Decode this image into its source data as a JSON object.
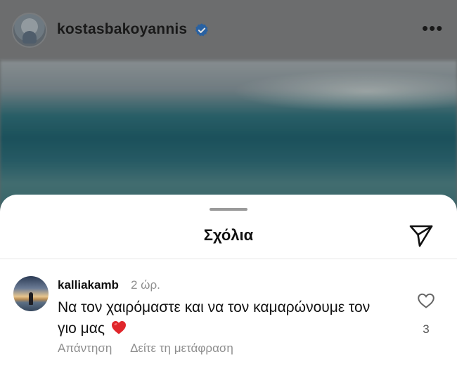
{
  "post": {
    "username": "kostasbakoyannis",
    "verified": true,
    "more_label": "•••",
    "icons": {
      "avatar": "profile-photo",
      "verified": "verified-badge-icon",
      "more": "more-options-icon"
    }
  },
  "comments_sheet": {
    "title": "Σχόλια",
    "share_icon": "send-icon",
    "comments": [
      {
        "username": "kalliakamb",
        "time": "2 ώρ.",
        "text": "Να τον χαιρόμαστε και να τον καμαρώνουμε τον γιο μας",
        "emoji": "heart",
        "reply_label": "Απάντηση",
        "translate_label": "Δείτε τη μετάφραση",
        "like_count": "3",
        "like_icon": "heart-outline-icon"
      }
    ]
  },
  "colors": {
    "heart_emoji": "#e0262b",
    "verified_badge": "#2f7fd8",
    "secondary_text": "#8e8e8e"
  }
}
